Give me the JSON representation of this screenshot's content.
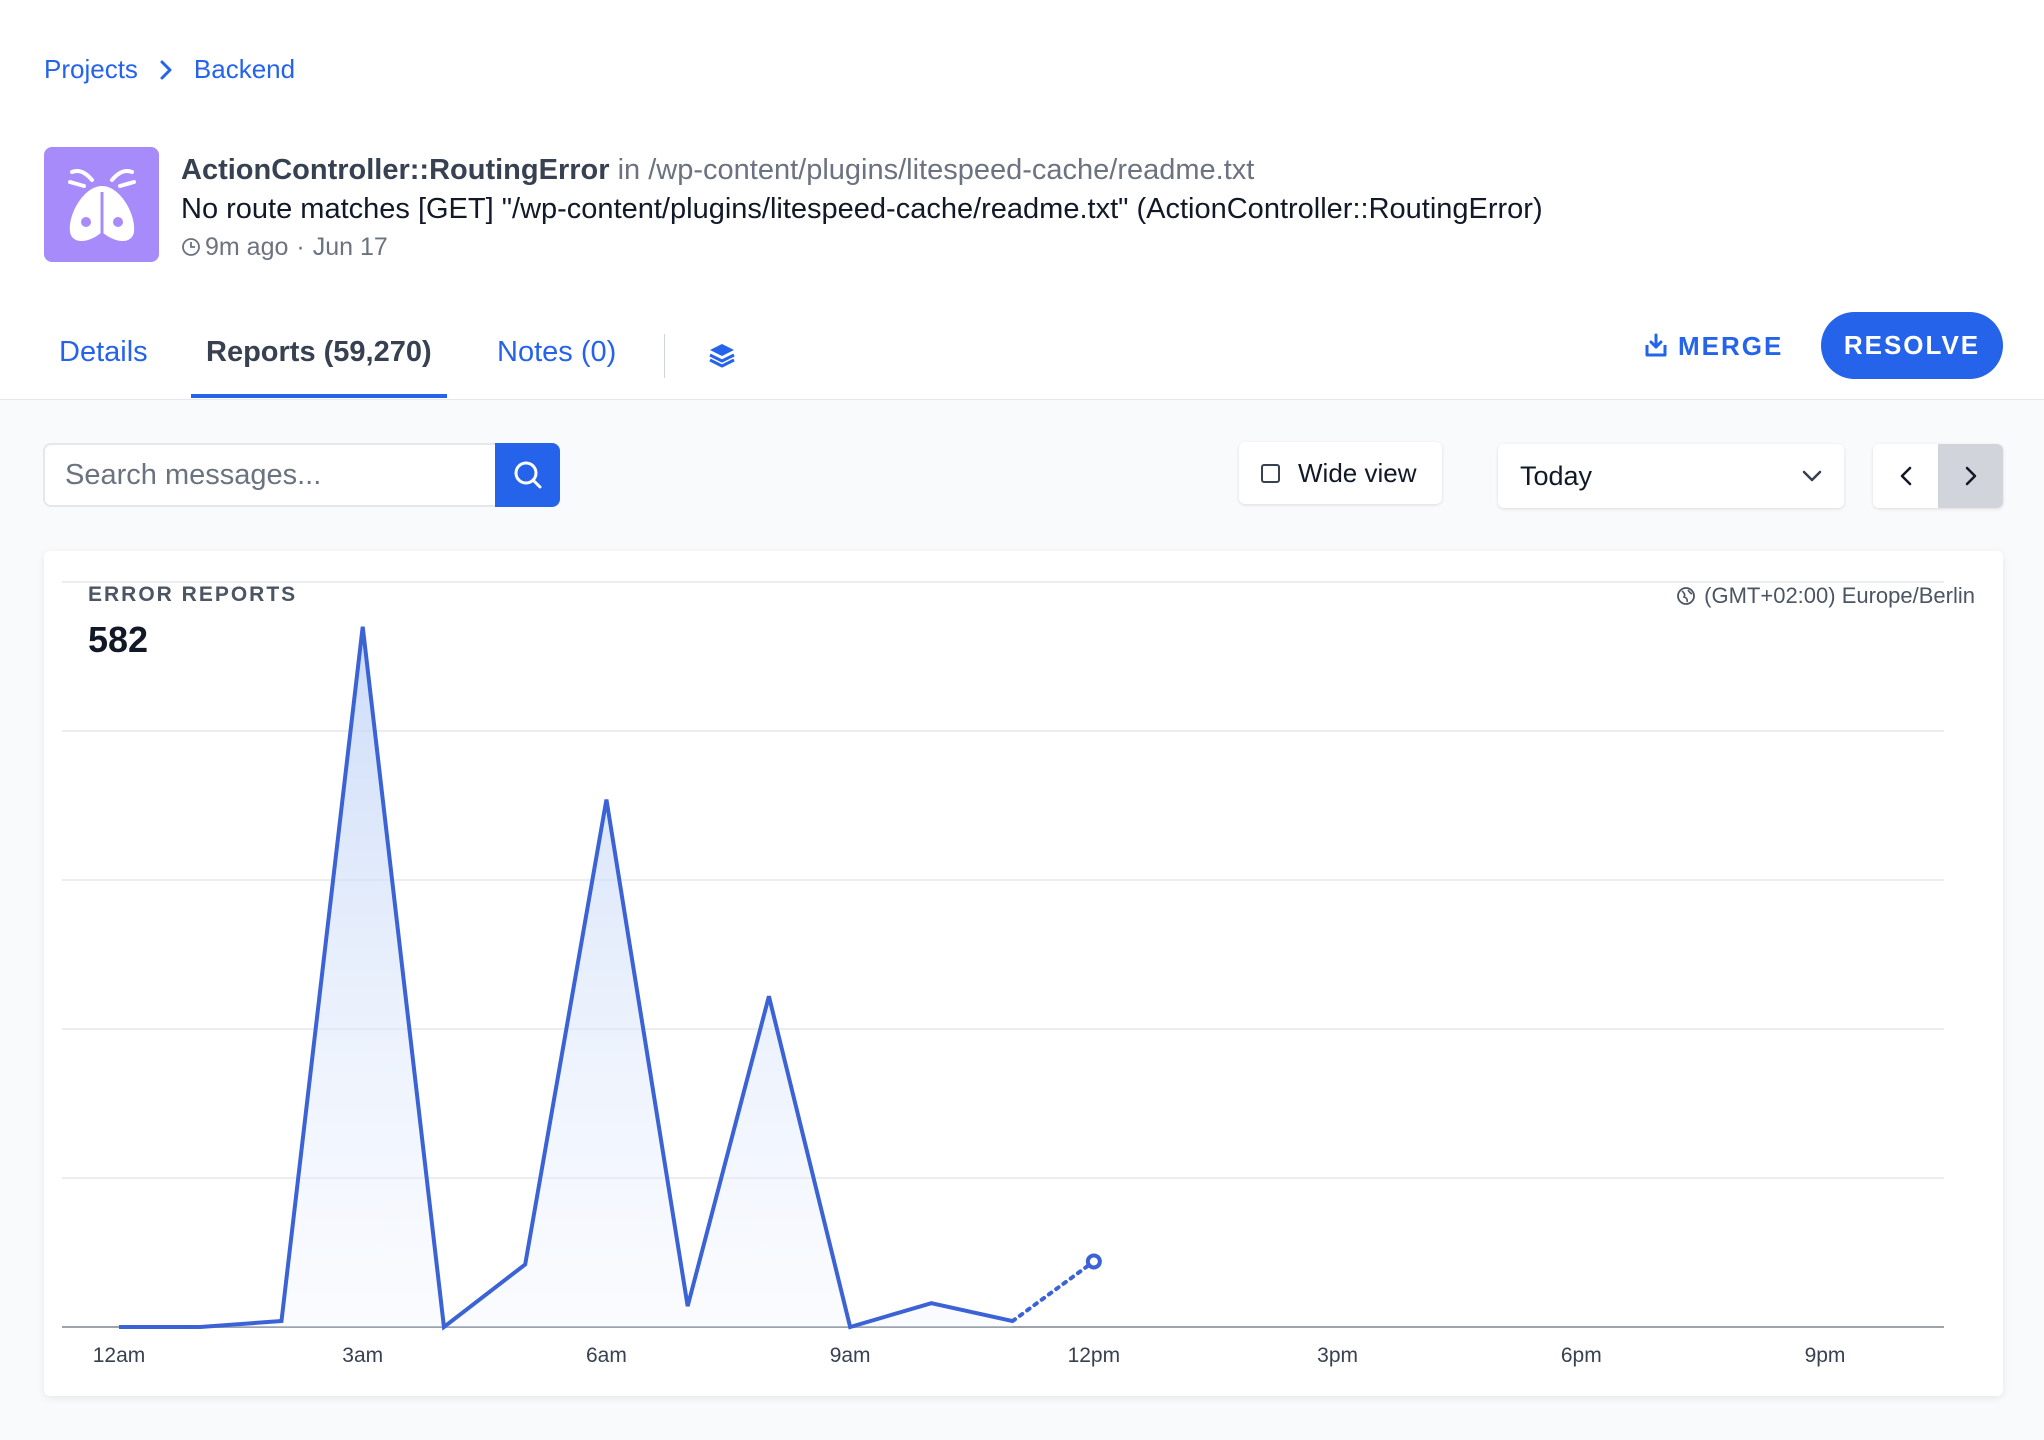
{
  "breadcrumb": {
    "items": [
      "Projects",
      "Backend"
    ]
  },
  "error": {
    "name": "ActionController::RoutingError",
    "in_word": "in",
    "location": "/wp-content/plugins/litespeed-cache/readme.txt",
    "message": "No route matches [GET] \"/wp-content/plugins/litespeed-cache/readme.txt\" (ActionController::RoutingError)",
    "time_ago": "9m ago",
    "date": "Jun 17",
    "meta_sep": "·",
    "avatar_color": "#a78bfa",
    "avatar_icon": "moth-icon"
  },
  "tabs": [
    {
      "label": "Details",
      "active": false
    },
    {
      "label": "Reports (59,270)",
      "active": true
    },
    {
      "label": "Notes (0)",
      "active": false
    }
  ],
  "actions": {
    "merge_label": "MERGE",
    "resolve_label": "RESOLVE"
  },
  "toolbar": {
    "search_placeholder": "Search messages...",
    "wide_view_label": "Wide view",
    "wide_view_checked": false,
    "period_selected": "Today"
  },
  "report_card": {
    "label": "ERROR REPORTS",
    "total": "582",
    "timezone": "(GMT+02:00) Europe/Berlin"
  },
  "colors": {
    "accent": "#2563eb",
    "line": "#3b63d6"
  },
  "chart_data": {
    "type": "line",
    "x_ticks": [
      "12am",
      "3am",
      "6am",
      "9am",
      "12pm",
      "3pm",
      "6pm",
      "9pm"
    ],
    "y_ticks": [
      0,
      50,
      100,
      150,
      200,
      250
    ],
    "ylim": [
      0,
      250
    ],
    "xlim_hours": [
      0,
      24
    ],
    "series": [
      {
        "x_hours": [
          0,
          1,
          2,
          3,
          4,
          5,
          6,
          7,
          8,
          9,
          10,
          11
        ],
        "values": [
          0,
          0,
          2,
          235,
          0,
          21,
          177,
          7,
          111,
          0,
          8,
          2
        ]
      }
    ],
    "partial": {
      "x_hours": [
        11,
        12
      ],
      "values": [
        2,
        22
      ]
    },
    "grid": true
  }
}
